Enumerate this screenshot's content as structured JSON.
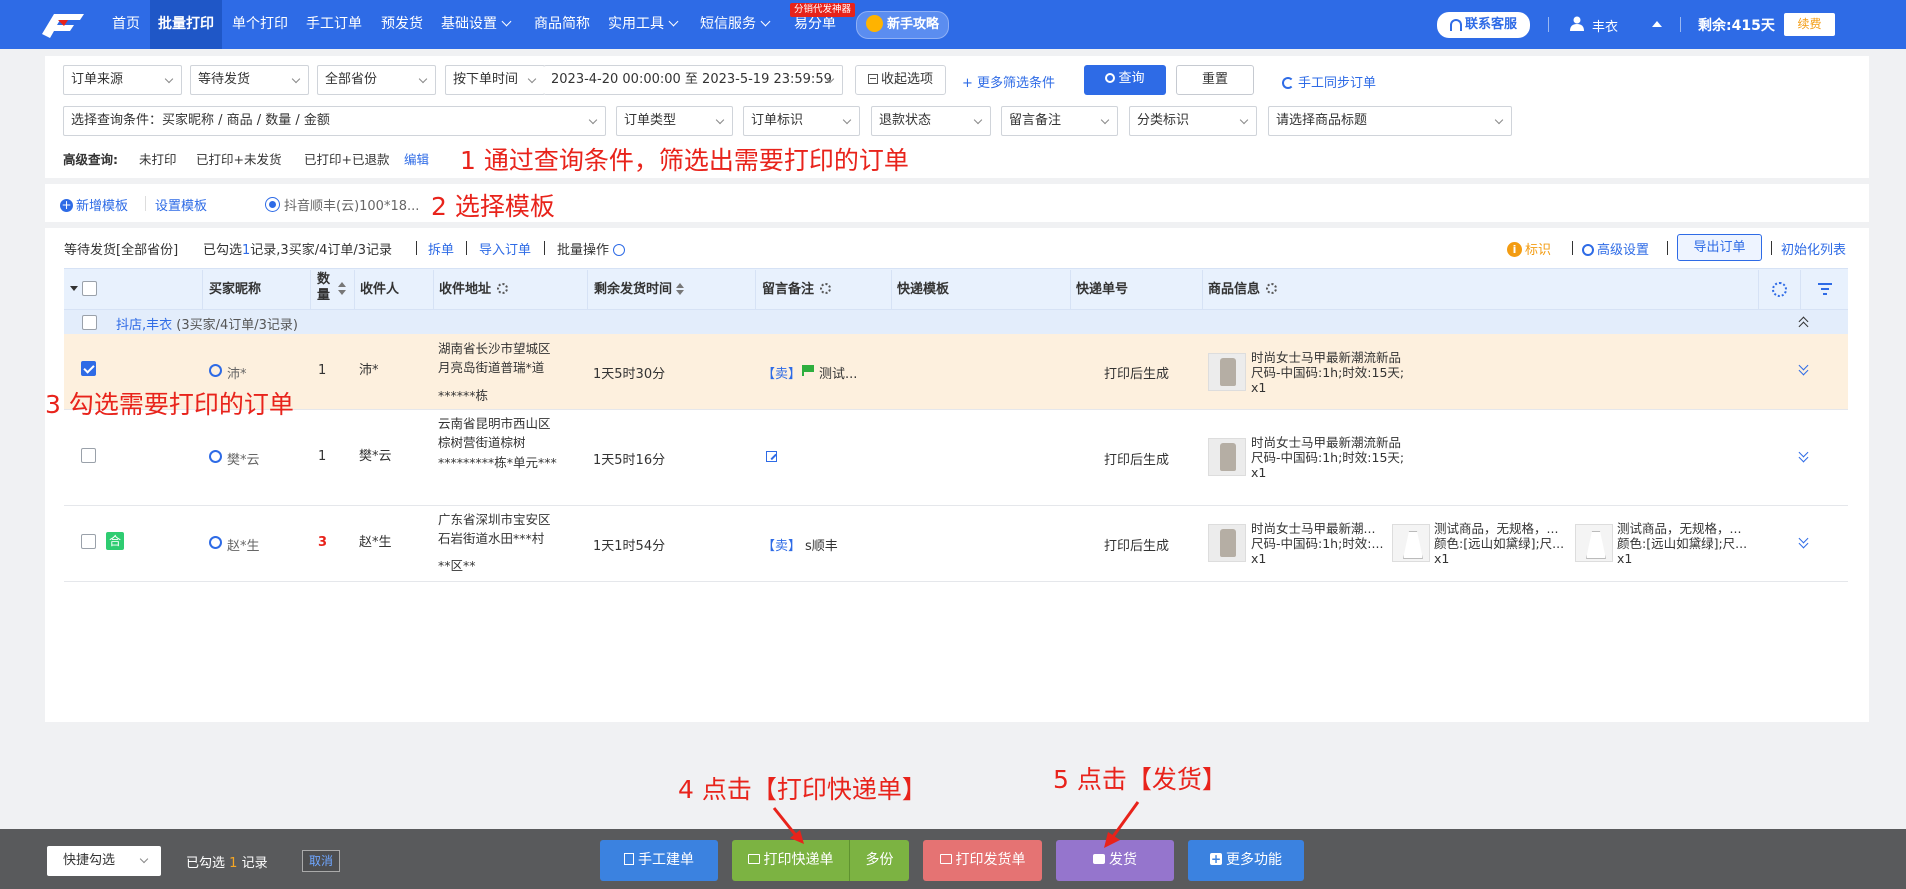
{
  "topbar": {
    "nav": [
      "首页",
      "批量打印",
      "单个打印",
      "手工订单",
      "预发货",
      "基础设置",
      "商品简称",
      "实用工具",
      "短信服务",
      "易分单"
    ],
    "yifendan_badge": "分销代发神器",
    "guide_label": "新手攻略",
    "service_label": "联系客服",
    "user_name": "丰衣",
    "remaining": "剩余:415天",
    "renew_label": "续费"
  },
  "filters": {
    "order_source": "订单来源",
    "status": "等待发货",
    "province": "全部省份",
    "time_type": "按下单时间",
    "date_range": "2023-4-20 00:00:00 至 2023-5-19 23:59:59",
    "collapse_label": "收起选项",
    "more_label": "+ 更多筛选条件",
    "query_label": "查询",
    "reset_label": "重置",
    "sync_label": "手工同步订单",
    "condition_placeholder": "选择查询条件：买家昵称 / 商品 / 数量 / 金额",
    "order_type": "订单类型",
    "order_flag": "订单标识",
    "refund_status": "退款状态",
    "remark": "留言备注",
    "category_flag": "分类标识",
    "product_title": "请选择商品标题",
    "advanced_label": "高级查询:",
    "advanced_items": [
      "未打印",
      "已打印+未发货",
      "已打印+已退款"
    ],
    "edit_label": "编辑"
  },
  "annotations": {
    "step1": "1 通过查询条件，筛选出需要打印的订单",
    "step2": "2 选择模板",
    "step3": "3 勾选需要打印的订单",
    "step4": "4 点击【打印快递单】",
    "step5": "5 点击【发货】"
  },
  "templates": {
    "add_label": "新增模板",
    "settings_label": "设置模板",
    "selected_template": "抖音顺丰(云)100*18..."
  },
  "list_toolbar": {
    "status_text": "等待发货[全部省份]",
    "selected_prefix": "已勾选",
    "selected_count": "1",
    "selected_suffix": "记录,3买家/4订单/3记录",
    "split_label": "拆单",
    "import_label": "导入订单",
    "batch_label": "批量操作",
    "flag_label": "标识",
    "advanced_settings_label": "高级设置",
    "export_label": "导出订单",
    "init_list_label": "初始化列表"
  },
  "table": {
    "headers": {
      "buyer": "买家昵称",
      "qty": "数量",
      "receiver": "收件人",
      "address": "收件地址",
      "time_left": "剩余发货时间",
      "remark": "留言备注",
      "template": "快递模板",
      "tracking": "快递单号",
      "product": "商品信息"
    },
    "group": {
      "name": "抖店,丰衣",
      "summary": "(3买家/4订单/3记录)"
    },
    "rows": [
      {
        "checked": true,
        "buyer": "沛*",
        "qty": "1",
        "receiver": "沛*",
        "address": [
          "湖南省长沙市望城区",
          "月亮岛街道普瑞*道",
          "******栋"
        ],
        "time_left": "1天5时30分",
        "remark_tag": "【卖】",
        "remark_text": "测试...",
        "tracking": "打印后生成",
        "products": [
          {
            "lines": [
              "时尚女士马甲最新潮流新品",
              "尺码-中国码:1h;时效:15天;",
              "x1"
            ]
          }
        ]
      },
      {
        "checked": false,
        "buyer": "樊*云",
        "qty": "1",
        "receiver": "樊*云",
        "address": [
          "云南省昆明市西山区",
          "棕树营街道棕树",
          "*********栋*单元***"
        ],
        "time_left": "1天5时16分",
        "remark_tag": "",
        "remark_text": "",
        "tracking": "打印后生成",
        "products": [
          {
            "lines": [
              "时尚女士马甲最新潮流新品",
              "尺码-中国码:1h;时效:15天;",
              "x1"
            ]
          }
        ]
      },
      {
        "checked": false,
        "merge_badge": "合",
        "buyer": "赵*生",
        "qty": "3",
        "receiver": "赵*生",
        "address": [
          "广东省深圳市宝安区",
          "石岩街道水田***村",
          "**区**"
        ],
        "time_left": "1天1时54分",
        "remark_tag": "【卖】",
        "remark_text": "s顺丰",
        "tracking": "打印后生成",
        "products": [
          {
            "lines": [
              "时尚女士马甲最新潮...",
              "尺码-中国码:1h;时效:...",
              "x1"
            ]
          },
          {
            "lines": [
              "测试商品，无规格，...",
              "颜色:[远山如黛绿];尺...",
              "x1"
            ]
          },
          {
            "lines": [
              "测试商品，无规格，...",
              "颜色:[远山如黛绿];尺...",
              "x1"
            ]
          }
        ]
      }
    ]
  },
  "footer": {
    "quick_select": "快捷勾选",
    "selected_prefix": "已勾选",
    "selected_count": "1",
    "selected_suffix": "记录",
    "cancel_label": "取消",
    "manual_label": "手工建单",
    "print_express_label": "打印快递单",
    "copies_label": "多份",
    "print_delivery_label": "打印发货单",
    "ship_label": "发货",
    "more_label": "更多功能"
  },
  "colors": {
    "primary": "#2e6be6",
    "annotation": "#e8231b",
    "print_express": "#7cb342",
    "print_delivery": "#e57373",
    "ship": "#9575cd"
  }
}
